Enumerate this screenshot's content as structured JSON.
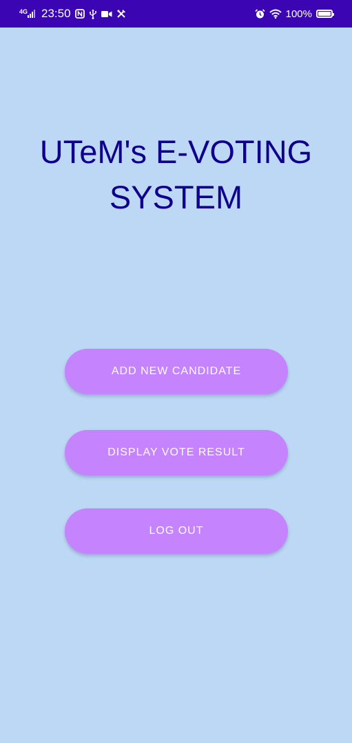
{
  "status_bar": {
    "network": "4G",
    "time": "23:50",
    "battery_percent": "100%",
    "battery_level": 1.0,
    "background_color": "#3b05b4",
    "left_icons": [
      "signal-icon",
      "nfc-icon",
      "usb-icon",
      "video-camera-icon",
      "tools-icon"
    ],
    "right_icons": [
      "alarm-icon",
      "wifi-icon",
      "battery-icon"
    ]
  },
  "main": {
    "title_line1": "UTeM's E-VOTING",
    "title_line2": "SYSTEM",
    "title_color": "#10008e",
    "background_color": "#bcd8f4"
  },
  "buttons": {
    "add_candidate_label": "ADD NEW CANDIDATE",
    "display_result_label": "DISPLAY VOTE RESULT",
    "logout_label": "LOG OUT",
    "color": "#c583fd"
  }
}
